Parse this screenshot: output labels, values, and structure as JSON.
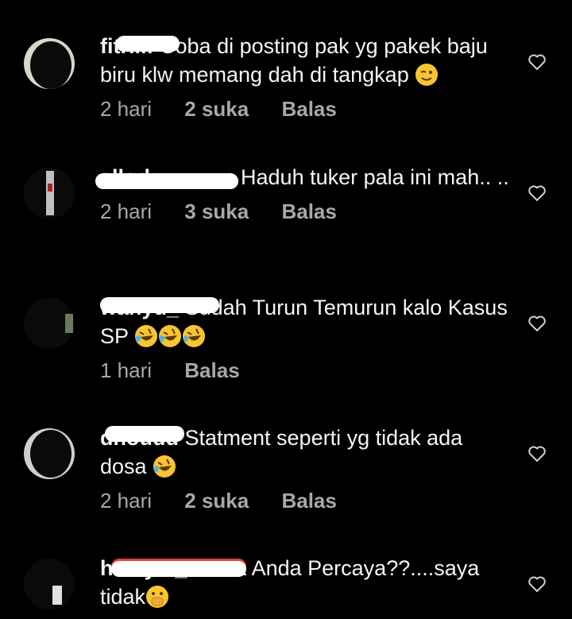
{
  "comments": [
    {
      "username": "fitrili",
      "username_suffix": "f",
      "text": "Coba di posting pak yg pakek baju biru klw memang dah di tangkap",
      "emoji": "winking-face-emoji",
      "time": "2 hari",
      "likes": "2 suka",
      "reply": "Balas"
    },
    {
      "username": "ellod",
      "username_suffix": "n",
      "text": "Haduh tuker pala ini mah.. ..",
      "time": "2 hari",
      "likes": "3 suka",
      "reply": "Balas"
    },
    {
      "username": "wahyu_",
      "username_suffix": "",
      "text": "Sudah Turun Temurun kalo Kasus SP",
      "emoji": "rolling-laughing-emoji",
      "time": "1 hari",
      "reply": "Balas"
    },
    {
      "username": "dhoud",
      "username_suffix": "d",
      "text": "Statment seperti yg tidak ada dosa",
      "emoji": "rolling-laughing-emoji",
      "time": "2 hari",
      "likes": "2 suka",
      "reply": "Balas"
    },
    {
      "username": "hidayat_",
      "username_suffix": "k",
      "text": "Anda Percaya??....saya tidak",
      "emoji": "hand-over-mouth-emoji"
    }
  ],
  "colors": {
    "background": "#000000",
    "text": "#f5f5f5",
    "meta": "#a8a8a8",
    "redaction": "#ffffff",
    "redaction_edge": "#e0453a"
  }
}
